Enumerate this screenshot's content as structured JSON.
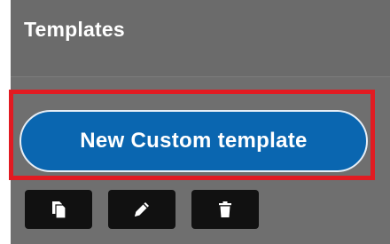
{
  "panel": {
    "title": "Templates"
  },
  "new_template_button": {
    "label": "New Custom template",
    "color": "#0a66b0"
  },
  "highlight": {
    "color": "#e11b22"
  },
  "toolbar": {
    "buttons": [
      {
        "icon": "copy-icon"
      },
      {
        "icon": "pencil-icon"
      },
      {
        "icon": "trash-icon"
      }
    ]
  }
}
